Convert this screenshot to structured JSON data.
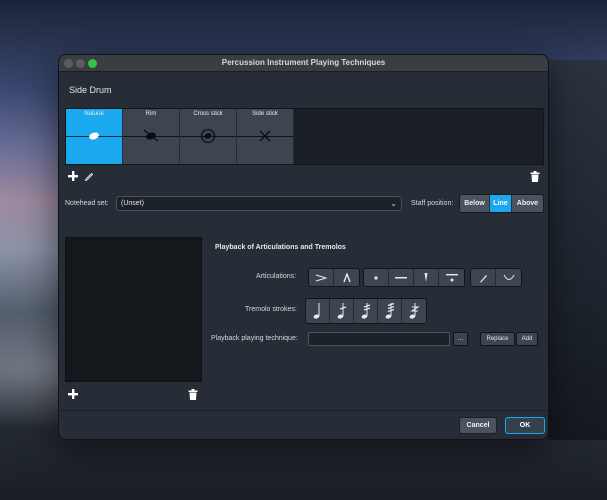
{
  "window": {
    "title": "Percussion Instrument Playing Techniques"
  },
  "instrument": {
    "name": "Side Drum"
  },
  "techniques": [
    {
      "label": "Natural",
      "selected": true,
      "notehead": "filled-oval-icon"
    },
    {
      "label": "Rim",
      "selected": false,
      "notehead": "crossed-oval-icon"
    },
    {
      "label": "Cross stick",
      "selected": false,
      "notehead": "circled-notehead-icon"
    },
    {
      "label": "Side stick",
      "selected": false,
      "notehead": "x-notehead-icon"
    }
  ],
  "notehead": {
    "label": "Notehead set:",
    "value": "(Unset)"
  },
  "staff_position": {
    "label": "Staff position:",
    "options": [
      "Below",
      "Line",
      "Above"
    ],
    "selected": "Line"
  },
  "playback": {
    "title": "Playback of Articulations and Tremolos",
    "articulations_label": "Articulations:",
    "tremolo_label": "Tremolo strokes:",
    "technique_label": "Playback playing technique:",
    "browse_label": "...",
    "replace_label": "Replace",
    "add_label": "Add"
  },
  "footer": {
    "cancel": "Cancel",
    "ok": "OK"
  },
  "colors": {
    "accent": "#1aa8ee",
    "window_bg": "#262d36",
    "panel_bg": "#14181d",
    "button_bg": "#3d4550"
  }
}
